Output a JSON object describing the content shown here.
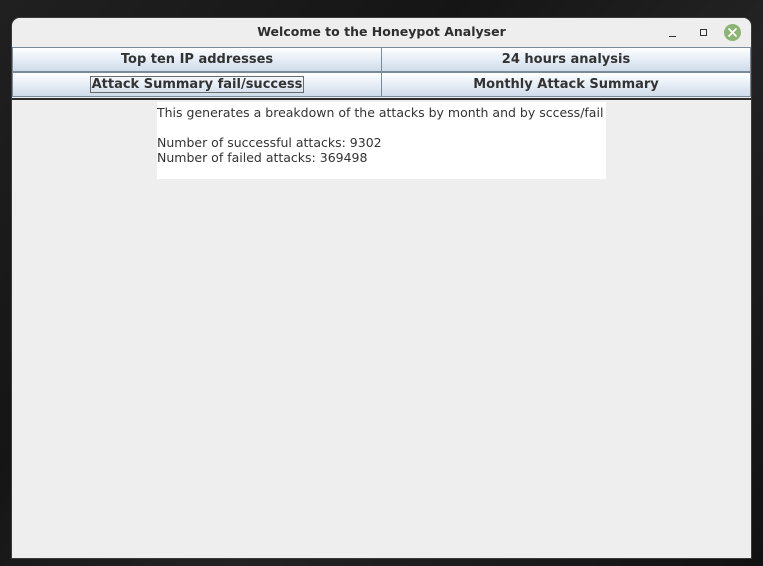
{
  "window": {
    "title": "Welcome to the Honeypot Analyser"
  },
  "controls": {
    "minimize_icon": "minimize-icon",
    "maximize_icon": "maximize-icon",
    "close_icon": "close-icon",
    "close_color": "#8cb573"
  },
  "buttons": {
    "top_ten": "Top ten IP addresses",
    "hours_24": "24 hours analysis",
    "summary": "Attack Summary fail/success",
    "monthly": "Monthly Attack Summary"
  },
  "output": {
    "description": "This generates a breakdown of the attacks by month and by sccess/fail",
    "successful": "Number of successful attacks: 9302",
    "failed": "Number of failed attacks: 369498"
  }
}
